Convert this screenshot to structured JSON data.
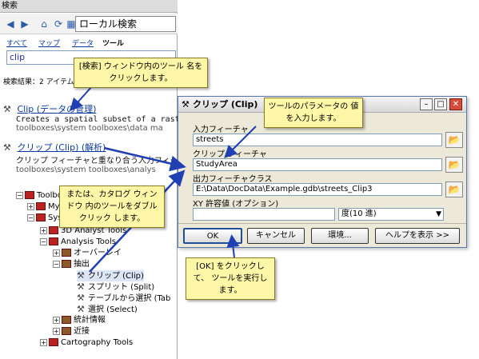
{
  "search_window": {
    "title": "検索",
    "local_search": "ローカル検索",
    "tabs": [
      "すべて",
      "マップ",
      "データ",
      "ツール"
    ],
    "query": "clip",
    "result_count": "検索結果：2 アイテム",
    "results": [
      {
        "title": "Clip (データの管理)",
        "desc": "Creates a spatial subset of a raster d",
        "path": "toolboxes\\system toolboxes\\data ma"
      },
      {
        "title": "クリップ (Clip) (解析)",
        "desc": "クリップ フィーチャと重なり合う入力フィーチ",
        "path": "toolboxes\\system toolboxes\\analys"
      }
    ],
    "tree": [
      {
        "label": "Toolbo",
        "level": 0
      },
      {
        "label": "My",
        "level": 1
      },
      {
        "label": "Sys",
        "level": 1
      },
      {
        "label": "3D Analyst Tools",
        "level": 2
      },
      {
        "label": "Analysis Tools",
        "level": 2
      },
      {
        "label": "オーバーレイ",
        "level": 3
      },
      {
        "label": "抽出",
        "level": 3
      },
      {
        "label": "クリップ (Clip)",
        "level": 4
      },
      {
        "label": "スプリット (Split)",
        "level": 4
      },
      {
        "label": "テーブルから選択 (Tab",
        "level": 4
      },
      {
        "label": "選択 (Select)",
        "level": 4
      },
      {
        "label": "統計情報",
        "level": 3
      },
      {
        "label": "近接",
        "level": 3
      },
      {
        "label": "Cartography Tools",
        "level": 2
      }
    ]
  },
  "clip_dialog": {
    "title": "クリップ (Clip)",
    "fields": [
      {
        "label": "入力フィーチャ",
        "value": "streets"
      },
      {
        "label": "クリップ フィーチャ",
        "value": "StudyArea"
      },
      {
        "label": "出力フィーチャクラス",
        "value": "E:\\Data\\DocData\\Example.gdb\\streets_Clip3"
      },
      {
        "label": "XY 許容値 (オプション)",
        "value": ""
      }
    ],
    "unit": "度(10 進)",
    "buttons": [
      "OK",
      "キャンセル",
      "環境...",
      "ヘルプを表示 >>"
    ]
  },
  "callouts": {
    "search": "[検索] ウィンドウ内のツール 名を クリックします。",
    "params": "ツールのパラメータの 値を入力します。",
    "catalog": "または、カタログ ウィンドウ 内のツールをダブルクリック します。",
    "run": "[OK] をクリックして、 ツールを実行します。"
  }
}
